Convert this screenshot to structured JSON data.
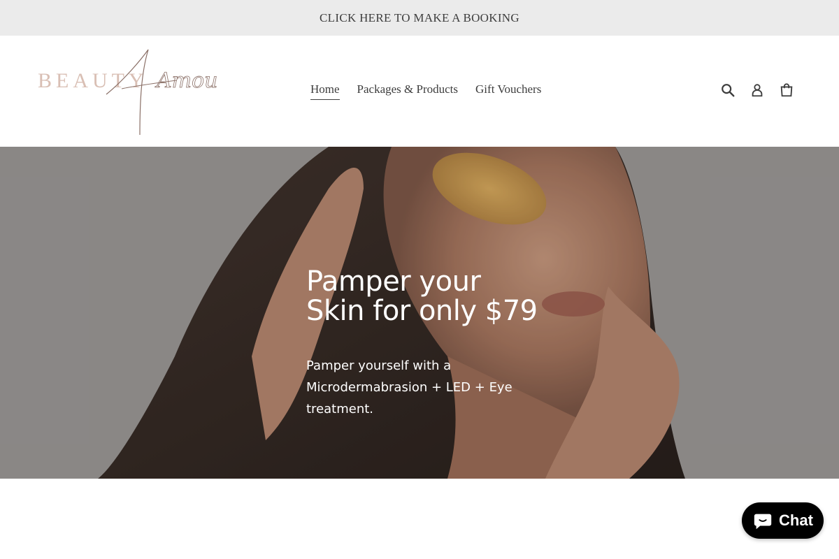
{
  "announcement": {
    "text": "CLICK HERE TO MAKE A BOOKING"
  },
  "logo": {
    "word1": "BEAUTY",
    "word2": "Amour"
  },
  "nav": {
    "items": [
      {
        "label": "Home",
        "active": true
      },
      {
        "label": "Packages & Products",
        "active": false
      },
      {
        "label": "Gift Vouchers",
        "active": false
      }
    ]
  },
  "header_icons": [
    "search-icon",
    "account-icon",
    "cart-icon"
  ],
  "hero": {
    "title_line1": "Pamper your",
    "title_line2": "Skin for only $79",
    "subtitle": "Pamper yourself with a Microdermabrasion + LED + Eye treatment."
  },
  "chat": {
    "label": "Chat"
  },
  "colors": {
    "announcement_bg": "#ebebeb",
    "logo_beauty": "#d9bfb4",
    "logo_amour": "#8a6f66",
    "text": "#3d3d3d",
    "chat_bg": "#000000"
  }
}
